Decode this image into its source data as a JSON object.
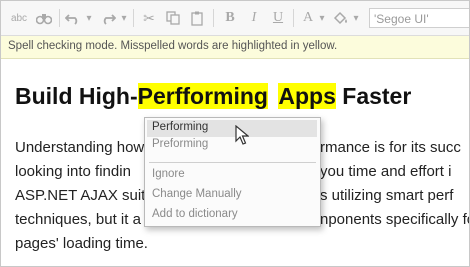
{
  "toolbar": {
    "spellcheck_label": "abc",
    "font_name": "'Segoe UI'"
  },
  "infobar": {
    "message": "Spell checking mode. Misspelled words are highlighted in yellow."
  },
  "document": {
    "heading_prefix": "Build High-",
    "heading_word1": "Perfforming",
    "heading_word2": "Apps",
    "heading_suffix": " Faster",
    "paragraph_lines": [
      "Understanding how",
      "looking into findin",
      "ASP.NET AJAX suit",
      "techniques, but it a",
      "pages' loading time."
    ],
    "paragraph_lines_right": [
      "rmance is for its succ",
      "you time and effort i",
      "s utilizing smart perf",
      "nponents specifically fo",
      ""
    ]
  },
  "context_menu": {
    "suggestions": [
      "Performing",
      "Preforming"
    ],
    "actions": [
      "Ignore",
      "Change Manually",
      "Add to dictionary"
    ]
  }
}
